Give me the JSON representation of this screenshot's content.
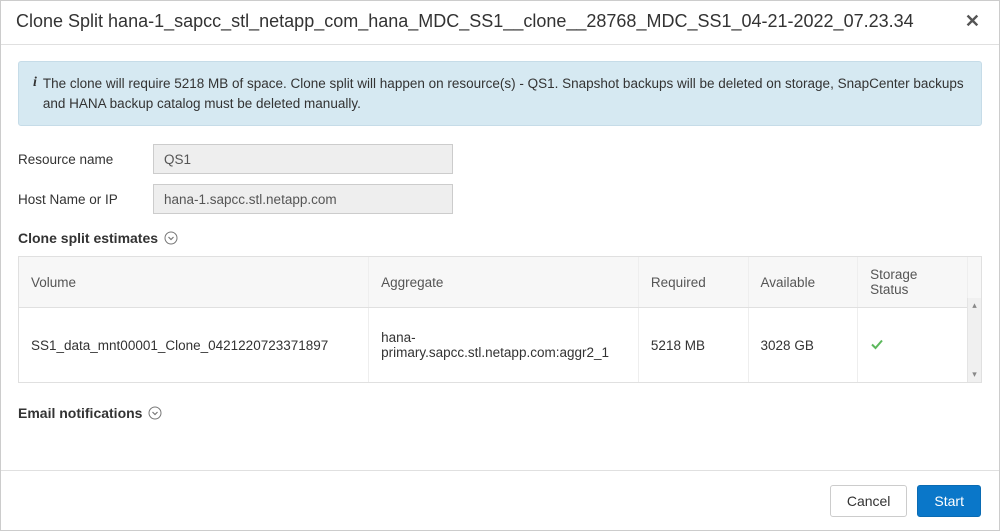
{
  "header": {
    "title": "Clone Split hana-1_sapcc_stl_netapp_com_hana_MDC_SS1__clone__28768_MDC_SS1_04-21-2022_07.23.34"
  },
  "banner": {
    "text": "The clone will require 5218 MB of space. Clone split will happen on resource(s) - QS1. Snapshot backups will be deleted on storage, SnapCenter backups and HANA backup catalog must be deleted manually."
  },
  "form": {
    "resource_name_label": "Resource name",
    "resource_name_value": "QS1",
    "host_label": "Host Name or IP",
    "host_value": "hana-1.sapcc.stl.netapp.com"
  },
  "sections": {
    "estimates_title": "Clone split estimates",
    "email_title": "Email notifications"
  },
  "table": {
    "headers": {
      "volume": "Volume",
      "aggregate": "Aggregate",
      "required": "Required",
      "available": "Available",
      "status": "Storage Status"
    },
    "rows": [
      {
        "volume": "SS1_data_mnt00001_Clone_0421220723371897",
        "aggregate": "hana-primary.sapcc.stl.netapp.com:aggr2_1",
        "required": "5218 MB",
        "available": "3028 GB",
        "status_icon": "check"
      }
    ]
  },
  "footer": {
    "cancel": "Cancel",
    "start": "Start"
  }
}
